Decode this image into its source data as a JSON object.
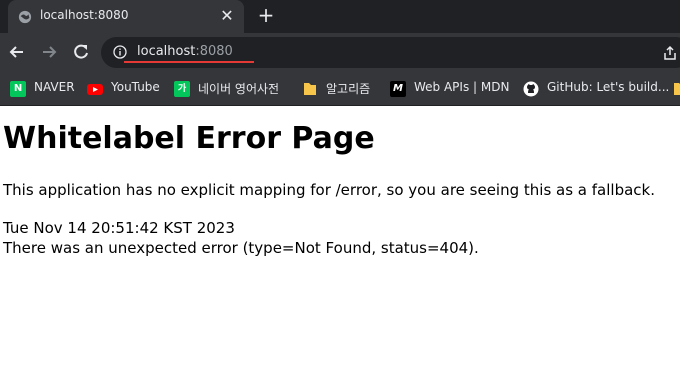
{
  "tab": {
    "title": "localhost:8080"
  },
  "address_bar": {
    "host": "localhost",
    "port": ":8080"
  },
  "bookmarks": [
    {
      "label": "NAVER",
      "icon": "naver-icon",
      "color": "#03c75a"
    },
    {
      "label": "YouTube",
      "icon": "youtube-icon",
      "color": "#ff0000"
    },
    {
      "label": "네이버 영어사전",
      "icon": "naver-dictionary-icon",
      "color": "#03c75a"
    },
    {
      "label": "알고리즘",
      "icon": "folder-icon",
      "color": "#f6c54a"
    },
    {
      "label": "Web APIs | MDN",
      "icon": "mdn-icon",
      "color": "#000000"
    },
    {
      "label": "GitHub: Let's build...",
      "icon": "github-icon",
      "color": "#ffffff"
    }
  ],
  "page": {
    "heading": "Whitelabel Error Page",
    "message": "This application has no explicit mapping for /error, so you are seeing this as a fallback.",
    "timestamp": "Tue Nov 14 20:51:42 KST 2023",
    "error": "There was an unexpected error (type=Not Found, status=404)."
  },
  "colors": {
    "underline": "#e53935",
    "chrome_dark": "#202124",
    "chrome_mid": "#35363a"
  }
}
